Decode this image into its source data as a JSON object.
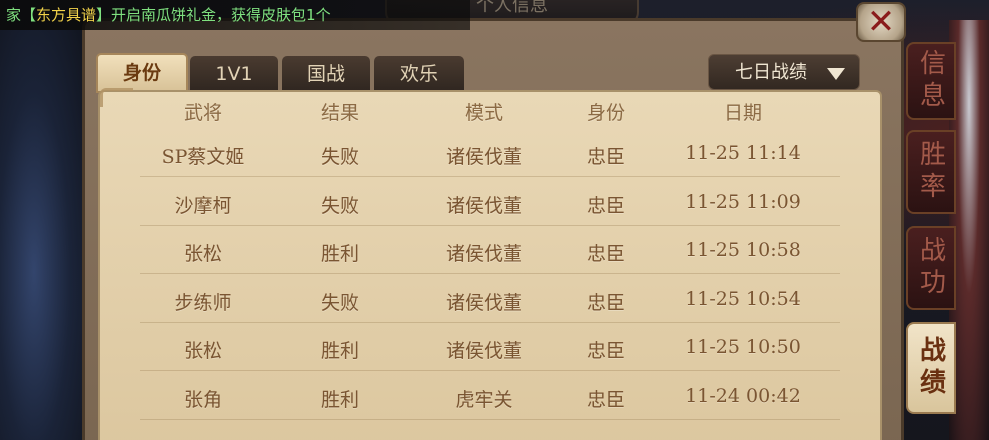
{
  "ticker": {
    "prefix": "家【",
    "highlight": "东方具谱",
    "suffix": "】开启南瓜饼礼金，获得皮肤包1个"
  },
  "title": "个人信息",
  "close_icon": "close-x-icon",
  "tabs": [
    {
      "label": "身份",
      "active": true
    },
    {
      "label": "1V1",
      "active": false
    },
    {
      "label": "国战",
      "active": false
    },
    {
      "label": "欢乐",
      "active": false
    }
  ],
  "dropdown": {
    "selected": "七日战绩",
    "icon": "triangle-down-icon"
  },
  "table": {
    "headers": [
      "武将",
      "结果",
      "模式",
      "身份",
      "日期"
    ],
    "rows": [
      [
        "SP蔡文姬",
        "失败",
        "诸侯伐董",
        "忠臣",
        "11-25 11:14"
      ],
      [
        "沙摩柯",
        "失败",
        "诸侯伐董",
        "忠臣",
        "11-25 11:09"
      ],
      [
        "张松",
        "胜利",
        "诸侯伐董",
        "忠臣",
        "11-25 10:58"
      ],
      [
        "步练师",
        "失败",
        "诸侯伐董",
        "忠臣",
        "11-25 10:54"
      ],
      [
        "张松",
        "胜利",
        "诸侯伐董",
        "忠臣",
        "11-25 10:50"
      ],
      [
        "张角",
        "胜利",
        "虎牢关",
        "忠臣",
        "11-24 00:42"
      ]
    ]
  },
  "side_tabs": [
    {
      "label": "信息",
      "active": false
    },
    {
      "label": "胜率",
      "active": false
    },
    {
      "label": "战功",
      "active": false
    },
    {
      "label": "战绩",
      "active": true
    }
  ],
  "colors": {
    "panel": "#8a7560",
    "table_bg": "#e9d8b6",
    "text": "#7a5532",
    "ticker": "#7fe07f"
  }
}
